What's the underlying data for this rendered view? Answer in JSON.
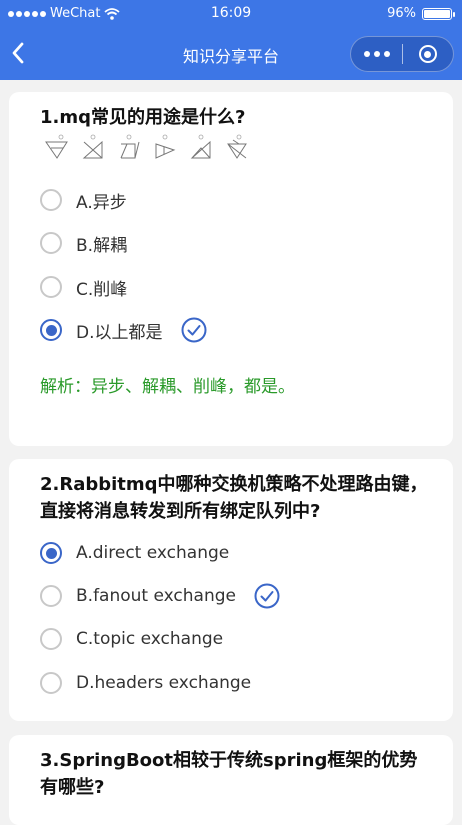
{
  "status": {
    "carrier": "WeChat",
    "time": "16:09",
    "battery": "96%",
    "battery_level": 0.96
  },
  "nav": {
    "title": "知识分享平台"
  },
  "questions": [
    {
      "title": "1.mq常见的用途是什么?",
      "options": [
        {
          "label": "A.异步",
          "selected": false,
          "correct": false
        },
        {
          "label": "B.解耦",
          "selected": false,
          "correct": false
        },
        {
          "label": "C.削峰",
          "selected": false,
          "correct": false
        },
        {
          "label": "D.以上都是",
          "selected": true,
          "correct": true
        }
      ],
      "analysis": "解析：异步、解耦、削峰，都是。"
    },
    {
      "title": "2.Rabbitmq中哪种交换机策略不处理路由键，直接将消息转发到所有绑定队列中?",
      "options": [
        {
          "label": "A.direct exchange",
          "selected": true,
          "correct": false
        },
        {
          "label": "B.fanout exchange",
          "selected": false,
          "correct": true
        },
        {
          "label": "C.topic exchange",
          "selected": false,
          "correct": false
        },
        {
          "label": "D.headers exchange",
          "selected": false,
          "correct": false
        }
      ]
    },
    {
      "title": "3.SpringBoot相较于传统spring框架的优势有哪些?"
    }
  ],
  "colors": {
    "primary": "#3d76e6",
    "radio_selected": "#3a66c8",
    "analysis": "#2a9a2a",
    "background": "#f2f2f2"
  },
  "icons": {
    "back": "chevron-left-icon",
    "more": "more-dots-icon",
    "close": "target-close-icon",
    "check": "circle-check-icon"
  }
}
